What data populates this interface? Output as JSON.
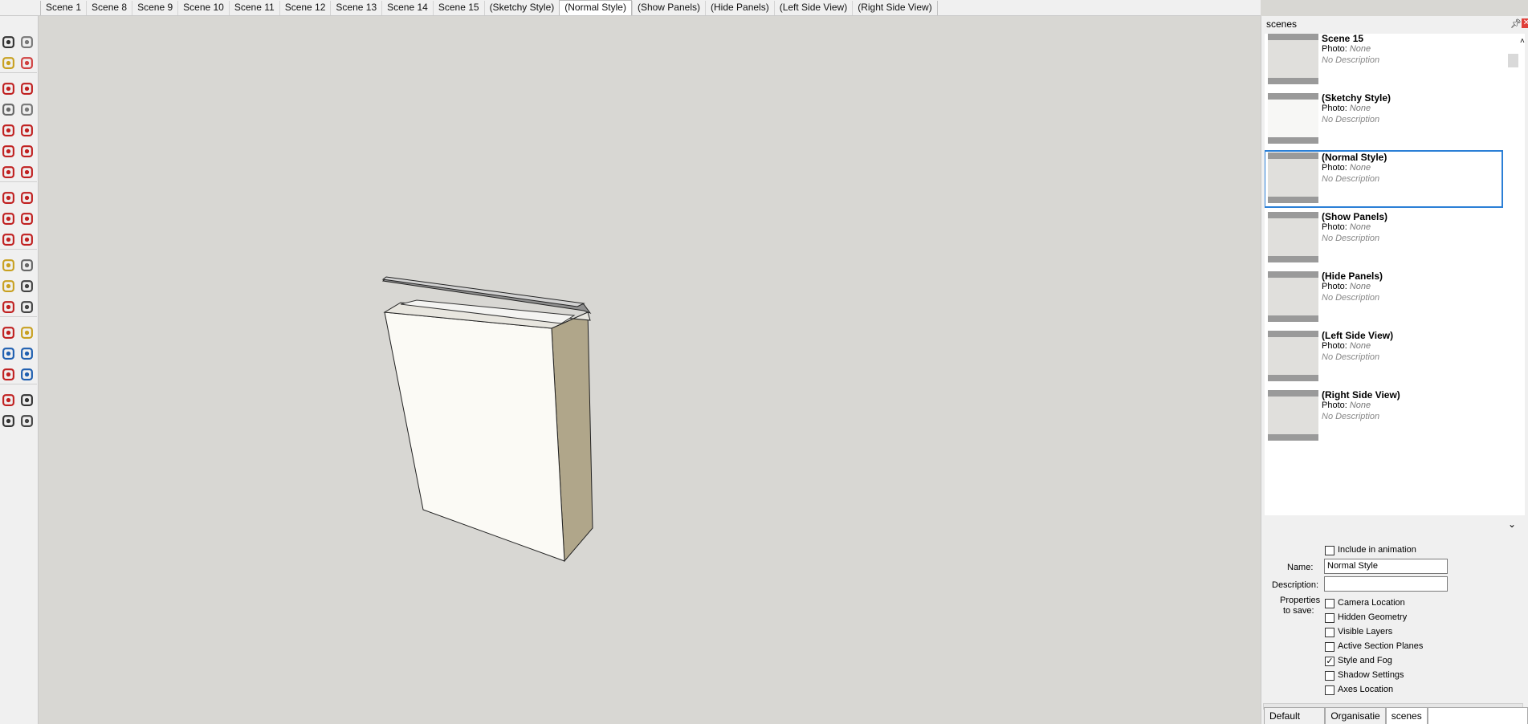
{
  "tabs": [
    "Scene 1",
    "Scene 8",
    "Scene 9",
    "Scene 10",
    "Scene 11",
    "Scene 12",
    "Scene 13",
    "Scene 14",
    "Scene 15",
    "(Sketchy Style)",
    "(Normal Style)",
    "(Show Panels)",
    "(Hide Panels)",
    "(Left Side View)",
    "(Right Side View)"
  ],
  "active_tab": "(Normal Style)",
  "tray": {
    "title": "scenes",
    "pin_icon": "pin-icon",
    "close_icon": "close-icon"
  },
  "scenes": [
    {
      "name": "Scene 15",
      "photo_label": "Photo:",
      "photo": "None",
      "description": "No Description"
    },
    {
      "name": "(Sketchy Style)",
      "photo_label": "Photo:",
      "photo": "None",
      "description": "No Description"
    },
    {
      "name": "(Normal Style)",
      "photo_label": "Photo:",
      "photo": "None",
      "description": "No Description"
    },
    {
      "name": "(Show Panels)",
      "photo_label": "Photo:",
      "photo": "None",
      "description": "No Description"
    },
    {
      "name": "(Hide Panels)",
      "photo_label": "Photo:",
      "photo": "None",
      "description": "No Description"
    },
    {
      "name": "(Left Side View)",
      "photo_label": "Photo:",
      "photo": "None",
      "description": "No Description"
    },
    {
      "name": "(Right Side View)",
      "photo_label": "Photo:",
      "photo": "None",
      "description": "No Description"
    }
  ],
  "selected_scene": "(Normal Style)",
  "details": {
    "include_label": "Include in animation",
    "include_checked": false,
    "name_label": "Name:",
    "name_value": "Normal Style",
    "description_label": "Description:",
    "description_value": "",
    "properties_label_1": "Properties",
    "properties_label_2": "to save:",
    "properties": [
      {
        "label": "Camera Location",
        "checked": false
      },
      {
        "label": "Hidden Geometry",
        "checked": false
      },
      {
        "label": "Visible Layers",
        "checked": false
      },
      {
        "label": "Active Section Planes",
        "checked": false
      },
      {
        "label": "Style and Fog",
        "checked": true
      },
      {
        "label": "Shadow Settings",
        "checked": false
      },
      {
        "label": "Axes Location",
        "checked": false
      }
    ]
  },
  "bottom_tabs": [
    "Default Tray",
    "Organisatie",
    "scenes"
  ],
  "active_bottom_tab": "scenes",
  "tools": [
    "select-icon",
    "make-component-icon",
    "paint-bucket-icon",
    "eraser-icon",
    "line-icon",
    "freehand-icon",
    "rectangle-icon",
    "rotated-rectangle-icon",
    "circle-icon",
    "polygon-icon",
    "arc-icon",
    "pie-icon",
    "two-point-arc-icon",
    "three-point-arc-icon",
    "move-icon",
    "push-pull-icon",
    "rotate-icon",
    "follow-me-icon",
    "scale-icon",
    "offset-icon",
    "tape-measure-icon",
    "dimension-icon",
    "protractor-icon",
    "text-icon",
    "axes-icon",
    "3d-text-icon",
    "orbit-icon",
    "pan-icon",
    "zoom-icon",
    "zoom-window-icon",
    "zoom-extents-icon",
    "previous-view-icon",
    "position-camera-icon",
    "look-around-icon",
    "walk-icon",
    "section-plane-icon"
  ],
  "colors": {
    "accent": "#2b7fd6",
    "viewport": "#d8d7d3",
    "box_front": "#fbfaf5",
    "box_side": "#b0a68a"
  }
}
